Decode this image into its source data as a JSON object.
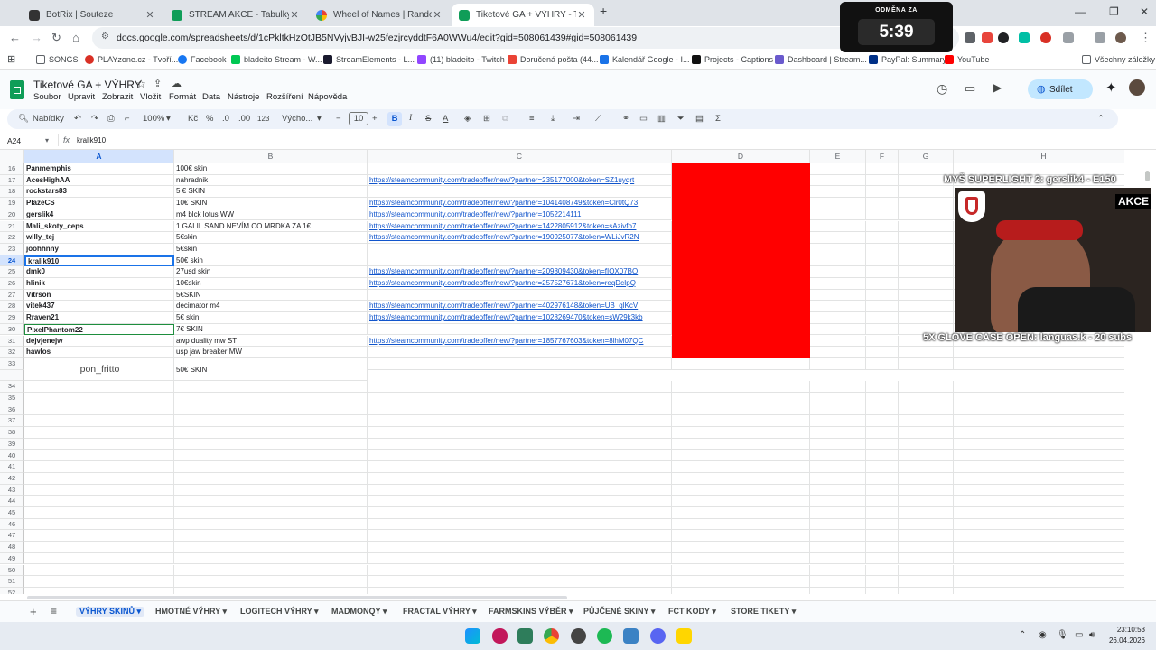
{
  "browser": {
    "tabs": [
      {
        "title": "BotRix | Souteze",
        "color": "#333333"
      },
      {
        "title": "STREAM AKCE - Tabulky Googl",
        "color": "#0f9d58"
      },
      {
        "title": "Wheel of Names | Random nam",
        "color": "#e94235"
      },
      {
        "title": "Tiketové GA + VÝHRY - Tabulky",
        "color": "#0f9d58"
      }
    ],
    "url": "docs.google.com/spreadsheets/d/1cPkltkHzOtJB5NVyjvBJI-w25fezjrcyddtF6A0WWu4/edit?gid=508061439#gid=508061439",
    "bookmarks": [
      {
        "label": "SONGS",
        "color": "#5f6368"
      },
      {
        "label": "PLAYzone.cz - Tvoří...",
        "color": "#d93025"
      },
      {
        "label": "Facebook",
        "color": "#1877f2"
      },
      {
        "label": "bladeito Stream - W...",
        "color": "#00c853"
      },
      {
        "label": "StreamElements - L...",
        "color": "#1a1a2e"
      },
      {
        "label": "(11) bladeito - Twitch",
        "color": "#9146ff"
      },
      {
        "label": "Doručená pošta (44...",
        "color": "#ea4335"
      },
      {
        "label": "Kalendář Google - I...",
        "color": "#1a73e8"
      },
      {
        "label": "Projects - Captions",
        "color": "#111111"
      },
      {
        "label": "Dashboard | Stream...",
        "color": "#6a5acd"
      },
      {
        "label": "PayPal: Summary",
        "color": "#003087"
      },
      {
        "label": "YouTube",
        "color": "#ff0000"
      }
    ],
    "all_bookmarks": "Všechny záložky"
  },
  "sheet": {
    "title": "Tiketové GA + VÝHRY",
    "menus": [
      "Soubor",
      "Upravit",
      "Zobrazit",
      "Vložit",
      "Formát",
      "Data",
      "Nástroje",
      "Rozšíření",
      "Nápověda"
    ],
    "share_label": "Sdílet",
    "toolbar": {
      "search": "Nabídky",
      "zoom": "100%",
      "currency": "Kč",
      "percent": "%",
      "dec_down": ".0",
      "dec_up": ".00",
      "format_123": "123",
      "font": "Výcho...",
      "font_size": "10"
    },
    "name_box": "A24",
    "formula": "kralik910",
    "columns": [
      "A",
      "B",
      "C",
      "D",
      "E",
      "F",
      "G",
      "H"
    ],
    "rows": [
      {
        "n": "16",
        "a": "Panmemphis",
        "b": "100€ skin",
        "c": ""
      },
      {
        "n": "17",
        "a": "AcesHighAA",
        "b": "nahradnik",
        "c": "https://steamcommunity.com/tradeoffer/new/?partner=235177000&token=SZ1uyqrt"
      },
      {
        "n": "18",
        "a": "rockstars83",
        "b": "5 € SKIN",
        "c": ""
      },
      {
        "n": "19",
        "a": "PlazeCS",
        "b": "10€ SKIN",
        "c": "https://steamcommunity.com/tradeoffer/new/?partner=1041408749&token=Clr0tQ73"
      },
      {
        "n": "20",
        "a": "gerslik4",
        "b": "m4 blck lotus WW",
        "c": "https://steamcommunity.com/tradeoffer/new/?partner=1052214111"
      },
      {
        "n": "21",
        "a": "Mali_skoty_ceps",
        "b": "1 GALIL SAND NEVÍM CO MRDKA ZA 1€",
        "c": "https://steamcommunity.com/tradeoffer/new/?partner=1422805912&token=sAzivfo7"
      },
      {
        "n": "22",
        "a": "willy_tej",
        "b": "5€skin",
        "c": "https://steamcommunity.com/tradeoffer/new/?partner=190925077&token=WLiJvR2N"
      },
      {
        "n": "23",
        "a": "joohhnny",
        "b": "5€skin",
        "c": ""
      },
      {
        "n": "24",
        "a": "kralik910",
        "b": "50€ skin",
        "c": ""
      },
      {
        "n": "25",
        "a": "dmk0",
        "b": "27usd skin",
        "c": "https://steamcommunity.com/tradeoffer/new/?partner=209809430&token=fIOX07BQ"
      },
      {
        "n": "26",
        "a": "hlinik",
        "b": "10€skin",
        "c": "https://steamcommunity.com/tradeoffer/new/?partner=257527671&token=reqDcIpQ"
      },
      {
        "n": "27",
        "a": "Vitrson",
        "b": "5€SKIN",
        "c": ""
      },
      {
        "n": "28",
        "a": "vitek437",
        "b": "decimator m4",
        "c": "https://steamcommunity.com/tradeoffer/new/?partner=402976148&token=UB_qlKcV"
      },
      {
        "n": "29",
        "a": "Rraven21",
        "b": "5€ skin",
        "c": "https://steamcommunity.com/tradeoffer/new/?partner=1028269470&token=sW29k3kb"
      },
      {
        "n": "30",
        "a": "PixelPhantom22",
        "b": "7€ SKIN",
        "c": ""
      },
      {
        "n": "31",
        "a": "dejvjenejw",
        "b": "awp duality mw ST",
        "c": "https://steamcommunity.com/tradeoffer/new/?partner=1857767603&token=8lhM07QC"
      },
      {
        "n": "32",
        "a": "hawlos",
        "b": "usp jaw breaker MW",
        "c": ""
      },
      {
        "n": "33",
        "a": "pon_fritto",
        "b": "50€ SKIN",
        "c": ""
      }
    ],
    "empty_rows": [
      "34",
      "35",
      "36",
      "37",
      "38",
      "39",
      "40",
      "41",
      "42",
      "43",
      "44",
      "45",
      "46",
      "47",
      "48",
      "49",
      "50",
      "51",
      "52"
    ],
    "sheet_tabs": [
      "VÝHRY SKINŮ",
      "HMOTNÉ VÝHRY",
      "LOGITECH VÝHRY",
      "MADMONQY",
      "FRACTAL VÝHRY",
      "FARMSKINS VÝBĚR",
      "PŮJČENÉ SKINY",
      "FCT KODY",
      "STORE TIKETY"
    ]
  },
  "overlay": {
    "timer_label": "ODMĚNA ZA",
    "timer_value": "5:39",
    "top_text": "MYŠ SUPERLIGHT 2: gerslik4 - E150",
    "akce": "AKCE",
    "bottom_text": "5X GLOVE CASE OPEN: languas.k - 20 subs"
  },
  "taskbar": {
    "time": "23:10:53",
    "date": "26.04.2026"
  }
}
